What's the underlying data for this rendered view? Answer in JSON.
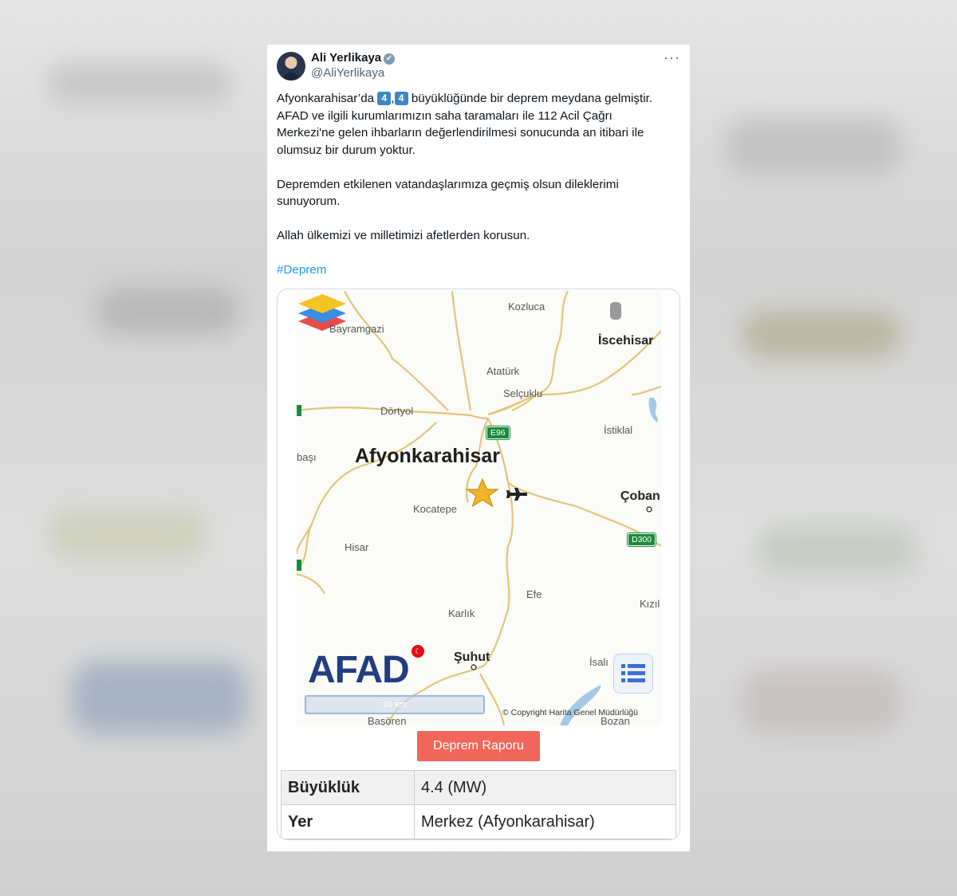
{
  "tweet": {
    "author_name": "Ali Yerlikaya",
    "handle": "@AliYerlikaya",
    "more": "···",
    "paragraph1_pre": "Afyonkarahisar’da ",
    "digit_a": "4",
    "comma": ",",
    "digit_b": "4",
    "paragraph1_post": " büyüklüğünde bir deprem meydana gelmiştir. AFAD ve ilgili kurumlarımızın saha taramaları ile 112 Acil Çağrı Merkezi'ne gelen ihbarların değerlendirilmesi sonucunda an itibari ile olumsuz bir durum yoktur.",
    "paragraph2": "Depremden etkilenen vatandaşlarımıza geçmiş olsun dileklerimi sunuyorum.",
    "paragraph3": "Allah ülkemizi ve milletimizi afetlerden korusun.",
    "hashtag": "#Deprem"
  },
  "card": {
    "map_labels": {
      "kozluca": "Kozluca",
      "bayramgazi": "Bayramgazi",
      "iscehisar": "İscehisar",
      "ataturk": "Atatürk",
      "selcuklu": "Selçuklu",
      "dortyol": "Dörtyol",
      "istiklal": "İstiklal",
      "basi": "başı",
      "afyonkarahisar": "Afyonkarahisar",
      "coban": "Çoban",
      "kocatepe": "Kocatepe",
      "hisar": "Hisar",
      "efe": "Efe",
      "kizil": "Kızıl",
      "karlik": "Karlık",
      "suhut": "Şuhut",
      "isali": "İsalı",
      "basoren": "Başören",
      "bozan": "Bozan"
    },
    "road_shields": {
      "e96": "E96",
      "d300": "D300"
    },
    "logo_text": "AFAD",
    "scale_label": "20 km",
    "copyright": "© Copyright Harita Genel Müdürlüğü",
    "report_button": "Deprem Raporu",
    "table": [
      {
        "key": "Büyüklük",
        "value": "4.4 (MW)"
      },
      {
        "key": "Yer",
        "value": "Merkez (Afyonkarahisar)"
      }
    ]
  },
  "colors": {
    "hashtag": "#1d9bf0",
    "report_button": "#f1665a",
    "afad_blue": "#223d80",
    "road": "#e8c877"
  }
}
